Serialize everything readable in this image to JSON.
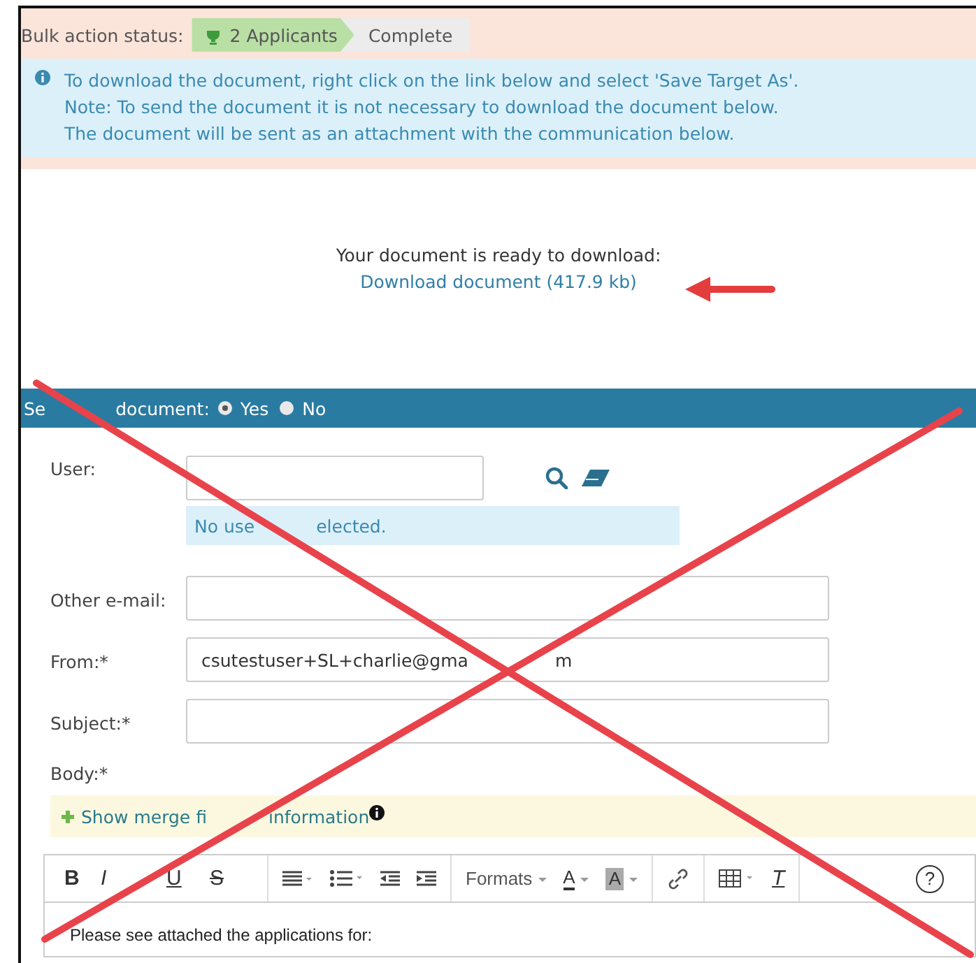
{
  "status": {
    "label": "Bulk action status:",
    "steps": [
      {
        "label": "2 Applicants",
        "selected": true
      },
      {
        "label": "Complete",
        "selected": false
      }
    ]
  },
  "info": {
    "lines": [
      "To download the document, right click on the link below and select 'Save Target As'.",
      "Note: To send the document it is not necessary to download the document below.",
      "The document will be sent as an attachment with the communication below."
    ]
  },
  "download": {
    "message": "Your document is ready to download:",
    "link": "Download document (417.9 kb)"
  },
  "send_bar": {
    "label": [
      "Se",
      "document:"
    ],
    "options": [
      {
        "label": "Yes",
        "selected": true
      },
      {
        "label": "No",
        "selected": false
      }
    ]
  },
  "form": {
    "user_label": "User:",
    "user_note": [
      "No use",
      "elected."
    ],
    "fields": [
      {
        "label": "Other e-mail:"
      },
      {
        "label": "From:*",
        "value": [
          "csutestuser+SL+charlie@gma",
          "m"
        ]
      },
      {
        "label": "Subject:*"
      }
    ],
    "body_label": "Body:*",
    "merge_link": [
      "Show merge fi",
      "information"
    ]
  },
  "toolbar": [
    {
      "kind": "bold",
      "label": "B"
    },
    {
      "kind": "italic",
      "label": "I"
    },
    {
      "kind": "underline",
      "label": "U"
    },
    {
      "kind": "strike",
      "label": "S"
    },
    {
      "kind": "align"
    },
    {
      "kind": "list"
    },
    {
      "kind": "outdent"
    },
    {
      "kind": "indent"
    },
    {
      "kind": "formats",
      "label": "Formats"
    },
    {
      "kind": "forecolor",
      "label": "A"
    },
    {
      "kind": "backcolor",
      "label": "A"
    },
    {
      "kind": "link"
    },
    {
      "kind": "table"
    },
    {
      "kind": "clear",
      "label": "T"
    },
    {
      "kind": "help",
      "label": "?"
    }
  ],
  "editor": {
    "text": "Please see attached the applications for:"
  }
}
